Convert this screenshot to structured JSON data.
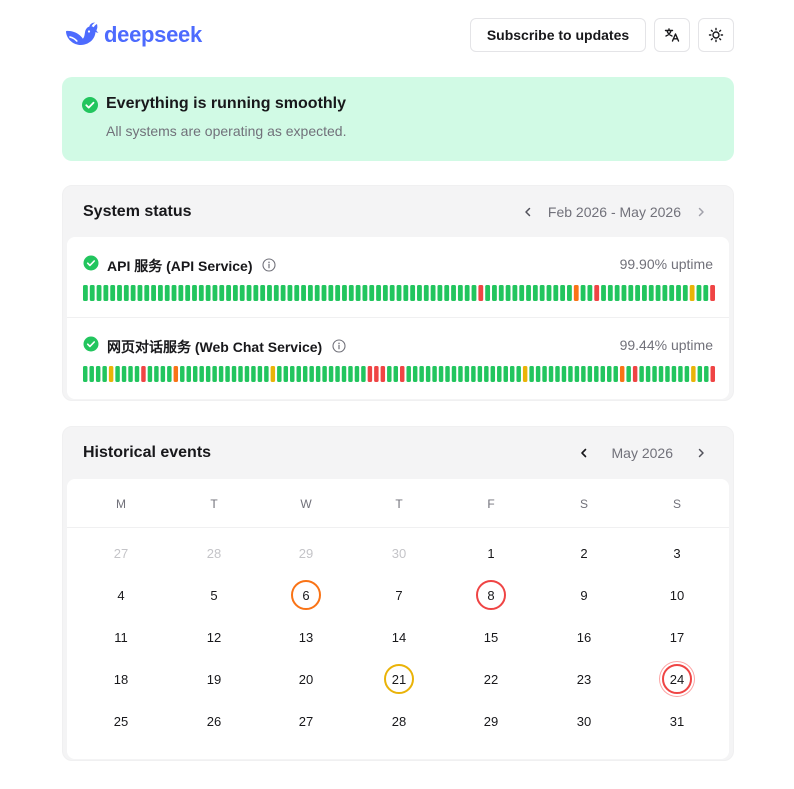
{
  "header": {
    "logo_text": "deepseek",
    "subscribe_label": "Subscribe to updates",
    "translate_icon": "translate-icon",
    "theme_icon": "sun-icon"
  },
  "banner": {
    "title": "Everything is running smoothly",
    "subtitle": "All systems are operating as expected."
  },
  "system_status": {
    "title": "System status",
    "range": "Feb 2026 - May 2026",
    "services": [
      {
        "name": "API 服务 (API Service)",
        "uptime": "99.90% uptime",
        "days": "ggggggggggggggggggggggggggggggggggggggggggggggggggggggggggrgggggggggggggoggrgggggggggggggyggr"
      },
      {
        "name": "网页对话服务 (Web Chat Service)",
        "uptime": "99.44% uptime",
        "days": "ggggyggggrggggoggggggggggggggyggggggggggggggrrrggrggggggggggggggggggyggggggggggggggogrggggggggyggr"
      }
    ]
  },
  "events": {
    "title": "Historical events",
    "month": "May 2026",
    "weekdays": [
      "M",
      "T",
      "W",
      "T",
      "F",
      "S",
      "S"
    ],
    "weeks": [
      [
        {
          "d": "27",
          "m": true
        },
        {
          "d": "28",
          "m": true
        },
        {
          "d": "29",
          "m": true
        },
        {
          "d": "30",
          "m": true
        },
        {
          "d": "1"
        },
        {
          "d": "2"
        },
        {
          "d": "3"
        }
      ],
      [
        {
          "d": "4"
        },
        {
          "d": "5"
        },
        {
          "d": "6",
          "ring": "#f97316"
        },
        {
          "d": "7"
        },
        {
          "d": "8",
          "ring": "#ef4444"
        },
        {
          "d": "9"
        },
        {
          "d": "10"
        }
      ],
      [
        {
          "d": "11"
        },
        {
          "d": "12"
        },
        {
          "d": "13"
        },
        {
          "d": "14"
        },
        {
          "d": "15"
        },
        {
          "d": "16"
        },
        {
          "d": "17"
        }
      ],
      [
        {
          "d": "18"
        },
        {
          "d": "19"
        },
        {
          "d": "20"
        },
        {
          "d": "21",
          "ring": "#eab308"
        },
        {
          "d": "22"
        },
        {
          "d": "23"
        },
        {
          "d": "24",
          "ring": "#ef4444",
          "today": true
        }
      ],
      [
        {
          "d": "25"
        },
        {
          "d": "26"
        },
        {
          "d": "27"
        },
        {
          "d": "28"
        },
        {
          "d": "29"
        },
        {
          "d": "30"
        },
        {
          "d": "31"
        }
      ]
    ]
  },
  "colors": {
    "brand": "#4d6bfe",
    "ok": "#22c55e",
    "minor": "#eab308",
    "major": "#f97316",
    "outage": "#ef4444"
  }
}
